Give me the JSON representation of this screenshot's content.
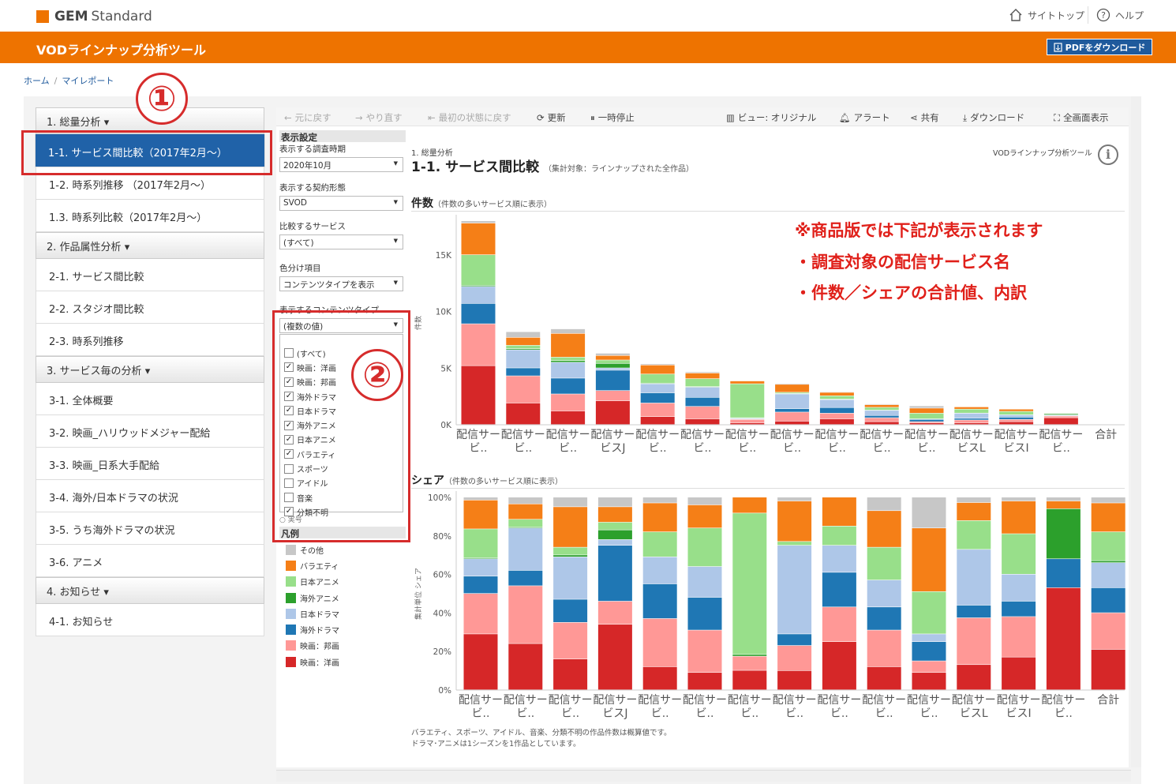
{
  "header": {
    "logo_bold": "GEM",
    "logo_rest": "Standard",
    "site_top": "サイトトップ",
    "help": "ヘルプ"
  },
  "app": {
    "title": "VODラインナップ分析ツール",
    "pdf_button": "PDFをダウンロード"
  },
  "breadcrumb": {
    "home": "ホーム",
    "current": "マイレポート"
  },
  "sidebar": {
    "s1": "1. 総量分析",
    "i11": "1-1. サービス間比較（2017年2月～）",
    "i12": "1-2. 時系列推移 （2017年2月～）",
    "i13": "1.3. 時系列比較（2017年2月～）",
    "s2": "2. 作品属性分析",
    "i21": "2-1. サービス間比較",
    "i22": "2-2. スタジオ間比較",
    "i23": "2-3. 時系列推移",
    "s3": "3. サービス毎の分析",
    "i31": "3-1. 全体概要",
    "i32": "3-2. 映画_ハリウッドメジャー配給",
    "i33": "3-3. 映画_日系大手配給",
    "i34": "3-4. 海外/日本ドラマの状況",
    "i35": "3-5. うち海外ドラマの状況",
    "i36": "3-6. アニメ",
    "s4": "4. お知らせ",
    "i41": "4-1. お知らせ"
  },
  "markers": {
    "m1": "①",
    "m2": "②"
  },
  "toolbar": {
    "undo": "元に戻す",
    "redo": "やり直す",
    "reset": "最初の状態に戻す",
    "refresh": "更新",
    "pause": "一時停止",
    "view": "ビュー: オリジナル",
    "alert": "アラート",
    "share": "共有",
    "download": "ダウンロード",
    "fullscreen": "全画面表示"
  },
  "filters": {
    "heading": "表示設定",
    "period_label": "表示する調査時期",
    "period_value": "2020年10月",
    "contract_label": "表示する契約形態",
    "contract_value": "SVOD",
    "service_label": "比較するサービス",
    "service_value": "(すべて)",
    "color_label": "色分け項目",
    "color_value": "コンテンツタイプを表示",
    "content_label": "表示するコンテンツタイプ",
    "content_value": "(複数の値)",
    "options": [
      {
        "label": "(すべて)",
        "checked": ""
      },
      {
        "label": "映画：洋画",
        "checked": "✓"
      },
      {
        "label": "映画：邦画",
        "checked": "✓"
      },
      {
        "label": "海外ドラマ",
        "checked": "✓"
      },
      {
        "label": "日本ドラマ",
        "checked": "✓"
      },
      {
        "label": "海外アニメ",
        "checked": "✓"
      },
      {
        "label": "日本アニメ",
        "checked": "✓"
      },
      {
        "label": "バラエティ",
        "checked": "✓"
      },
      {
        "label": "スポーツ",
        "checked": ""
      },
      {
        "label": "アイドル",
        "checked": ""
      },
      {
        "label": "音楽",
        "checked": ""
      },
      {
        "label": "分類不明",
        "checked": "✓"
      }
    ],
    "hidden_radio": "実号"
  },
  "legend": {
    "title": "凡例",
    "items": [
      {
        "label": "その他",
        "color": "#c7c7c7"
      },
      {
        "label": "バラエティ",
        "color": "#f57f17"
      },
      {
        "label": "日本アニメ",
        "color": "#98df8a"
      },
      {
        "label": "海外アニメ",
        "color": "#2ca02c"
      },
      {
        "label": "日本ドラマ",
        "color": "#aec7e8"
      },
      {
        "label": "海外ドラマ",
        "color": "#1f77b4"
      },
      {
        "label": "映画：邦画",
        "color": "#ff9896"
      },
      {
        "label": "映画：洋画",
        "color": "#d62728"
      }
    ]
  },
  "report": {
    "section": "1. 総量分析",
    "title": "1-1. サービス間比較",
    "subtitle": "（集計対象：ラインナップされた全作品）",
    "tool_name": "VODラインナップ分析ツール",
    "info_icon": "i"
  },
  "notice": {
    "line1": "※商品版では下記が表示されます",
    "line2": "・調査対象の配信サービス名",
    "line3": "・件数／シェアの合計値、内訳"
  },
  "footer": {
    "line1": "バラエティ、スポーツ、アイドル、音楽、分類不明の作品件数は概算値です。",
    "line2": "ドラマ･アニメは1シーズンを1作品としています。"
  },
  "chart_data": [
    {
      "type": "bar",
      "stacked": true,
      "title": "件数",
      "subtitle": "（件数の多いサービス順に表示）",
      "ylabel": "件数",
      "yticks": [
        "0K",
        "5K",
        "10K",
        "15K"
      ],
      "ylim": [
        0,
        18000
      ],
      "categories": [
        "配信サー ビ..",
        "配信サー ビ..",
        "配信サー ビ..",
        "配信サー ビスJ",
        "配信サー ビ..",
        "配信サー ビ..",
        "配信サー ビ..",
        "配信サー ビ..",
        "配信サー ビ..",
        "配信サー ビ..",
        "配信サー ビ..",
        "配信サー ビスL",
        "配信サー ビスI",
        "配信サー ビ.."
      ],
      "total_label": "合計",
      "series_order": [
        "映画：洋画",
        "映画：邦画",
        "海外ドラマ",
        "日本ドラマ",
        "海外アニメ",
        "日本アニメ",
        "バラエティ",
        "その他"
      ],
      "values": [
        [
          5200,
          3700,
          1800,
          1500,
          100,
          2700,
          2800,
          200
        ],
        [
          1900,
          2400,
          700,
          1600,
          100,
          300,
          700,
          500
        ],
        [
          1200,
          1500,
          1400,
          1400,
          150,
          300,
          2100,
          400
        ],
        [
          2100,
          900,
          1800,
          200,
          400,
          300,
          400,
          200
        ],
        [
          700,
          1200,
          900,
          800,
          60,
          800,
          800,
          100
        ],
        [
          500,
          1100,
          800,
          900,
          50,
          700,
          500,
          100
        ],
        [
          150,
          300,
          50,
          50,
          50,
          3000,
          250,
          0
        ],
        [
          300,
          800,
          300,
          1300,
          50,
          100,
          700,
          80
        ],
        [
          500,
          500,
          500,
          700,
          40,
          300,
          300,
          60
        ],
        [
          250,
          350,
          200,
          450,
          20,
          250,
          230,
          70
        ],
        [
          150,
          100,
          200,
          50,
          0,
          500,
          450,
          200
        ],
        [
          150,
          250,
          150,
          450,
          10,
          350,
          200,
          40
        ],
        [
          250,
          200,
          200,
          200,
          10,
          300,
          200,
          30
        ],
        [
          600,
          150,
          50,
          50,
          100,
          50,
          0,
          10
        ]
      ]
    },
    {
      "type": "bar",
      "stacked": true,
      "title": "シェア",
      "subtitle": "（件数の多いサービス順に表示）",
      "ylabel": "集計単位 シェア",
      "yticks": [
        "0%",
        "20%",
        "40%",
        "60%",
        "80%",
        "100%"
      ],
      "ylim": [
        0,
        100
      ],
      "categories": [
        "配信サー ビ..",
        "配信サー ビ..",
        "配信サー ビ..",
        "配信サー ビスJ",
        "配信サー ビ..",
        "配信サー ビ..",
        "配信サー ビ..",
        "配信サー ビ..",
        "配信サー ビ..",
        "配信サー ビ..",
        "配信サー ビ..",
        "配信サー ビスL",
        "配信サー ビスI",
        "配信サー ビ.."
      ],
      "total_label": "合計",
      "series_order": [
        "映画：洋画",
        "映画：邦画",
        "海外ドラマ",
        "日本ドラマ",
        "海外アニメ",
        "日本アニメ",
        "バラエティ",
        "その他"
      ],
      "values": [
        [
          29,
          21,
          9,
          9,
          0.5,
          15,
          15,
          1.5
        ],
        [
          24,
          30,
          8,
          22,
          0.5,
          4,
          8,
          3.5
        ],
        [
          16,
          19,
          12,
          22,
          1,
          4,
          21,
          5
        ],
        [
          34,
          12,
          29,
          3,
          5,
          4,
          8,
          5
        ],
        [
          12,
          25,
          18,
          14,
          0,
          13,
          15,
          3
        ],
        [
          9,
          22,
          17,
          16,
          0,
          20,
          12,
          4
        ],
        [
          11,
          8,
          0,
          0,
          1,
          80,
          9,
          0
        ],
        [
          10,
          13,
          6,
          46,
          0,
          2,
          21,
          2
        ],
        [
          25,
          18,
          18,
          14,
          0,
          10,
          15,
          0
        ],
        [
          12,
          19,
          12,
          14,
          0,
          17,
          19,
          7
        ],
        [
          9,
          6,
          10,
          4,
          0,
          22,
          33,
          16
        ],
        [
          14,
          26,
          7,
          31,
          0,
          16,
          10,
          3
        ],
        [
          17,
          21,
          8,
          14,
          0,
          21,
          17,
          2
        ],
        [
          53,
          0,
          15,
          0,
          26,
          0,
          4,
          2
        ],
        [
          21,
          19,
          13,
          13,
          1,
          15,
          15,
          3
        ]
      ]
    }
  ]
}
